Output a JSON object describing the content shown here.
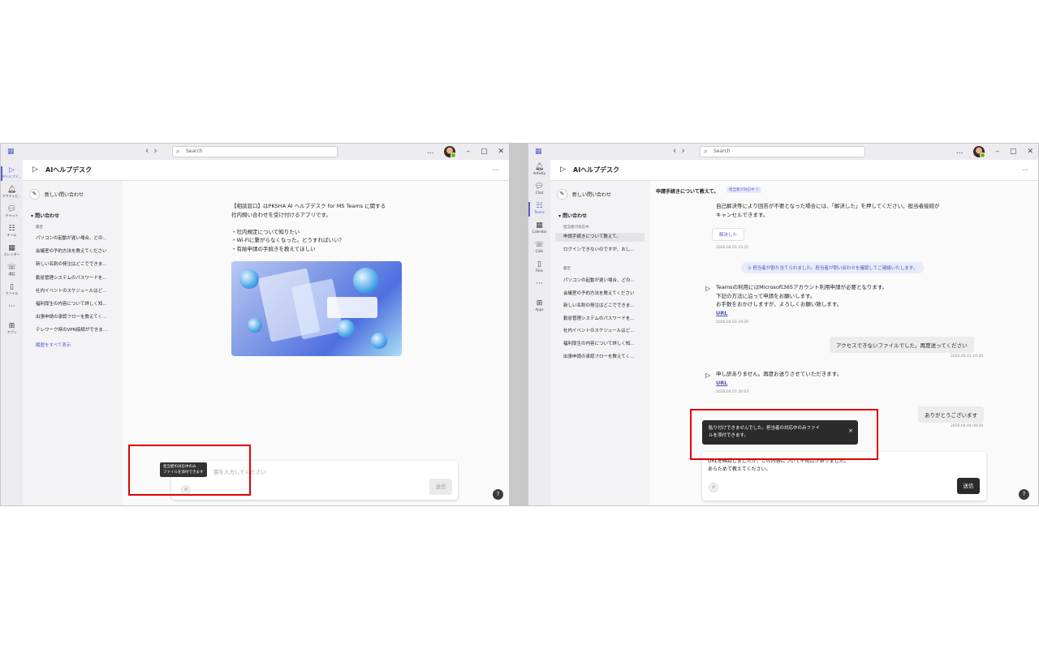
{
  "common": {
    "search_placeholder": "Search",
    "app_title": "AIヘルプデスク",
    "new_chat": "新しい問い合わせ",
    "section_header": "問い合わせ",
    "recent_label": "最近",
    "send_label": "送信",
    "help": "?",
    "more": "..."
  },
  "left": {
    "rail": [
      {
        "label": "AIヘルプデ...",
        "icon": "play-icon",
        "glyph": "▷",
        "active": true
      },
      {
        "label": "アクティビ...",
        "icon": "bell-icon",
        "glyph": "🔔︎",
        "active": false
      },
      {
        "label": "チャット",
        "icon": "chat-icon",
        "glyph": "💬︎",
        "active": false
      },
      {
        "label": "チーム",
        "icon": "teams-icon",
        "glyph": "☷",
        "active": false
      },
      {
        "label": "カレンダー",
        "icon": "calendar-icon",
        "glyph": "▦",
        "active": false
      },
      {
        "label": "通話",
        "icon": "phone-icon",
        "glyph": "☏",
        "active": false
      },
      {
        "label": "ファイル",
        "icon": "file-icon",
        "glyph": "▯",
        "active": false
      },
      {
        "label": "",
        "icon": "more-icon",
        "glyph": "···",
        "active": false
      },
      {
        "label": "アプリ",
        "icon": "apps-icon",
        "glyph": "⊞",
        "active": false
      }
    ],
    "recent_items": [
      "パソコンの起動が遅い場合、どの...",
      "会議室の予約方法を教えてください",
      "新しい名刺の発注はどこでできま...",
      "勤怠管理システムのパスワードを...",
      "社内イベントのスケジュールはど...",
      "福利厚生の内容について詳しく知...",
      "出張申請の承認フローを教えてく...",
      "テレワーク時のVPN接続ができま..."
    ],
    "show_all": "履歴をすべて表示",
    "welcome_lines": [
      "【相談窓口】はPKSHA AI ヘルプデスク for MS Teams に関する",
      "社内問い合わせを受け付けるアプリです。",
      "",
      "・社内規定について知りたい",
      "・Wi-Fiに繋がらなくなった。どうすればいい？",
      "・有給申請の手続きを教えてほしい"
    ],
    "composer_placeholder": "容を入力してください",
    "tooltip_lines": [
      "担当者の対応中のみ",
      "ファイルを添付できます"
    ]
  },
  "right": {
    "rail": [
      {
        "label": "Activity",
        "icon": "bell-icon",
        "glyph": "🔔︎",
        "active": false
      },
      {
        "label": "Chat",
        "icon": "chat-icon",
        "glyph": "💬︎",
        "active": false
      },
      {
        "label": "Teams",
        "icon": "teams-icon",
        "glyph": "☷",
        "active": true
      },
      {
        "label": "Calendar",
        "icon": "calendar-icon",
        "glyph": "▦",
        "active": false
      },
      {
        "label": "Calls",
        "icon": "phone-icon",
        "glyph": "☏",
        "active": false
      },
      {
        "label": "Files",
        "icon": "file-icon",
        "glyph": "▯",
        "active": false
      },
      {
        "label": "",
        "icon": "more-icon",
        "glyph": "···",
        "active": false
      },
      {
        "label": "Apps",
        "icon": "apps-icon",
        "glyph": "⊞",
        "active": false
      }
    ],
    "agent_label": "担当者が対応中",
    "agent_items": [
      "申請手続きについて教えて。",
      "ログインできないのですが、おし..."
    ],
    "recent_items": [
      "パソコンの起動が遅い場合、どの...",
      "会議室の予約方法を教えてください",
      "新しい名刺の発注はどこでできま...",
      "勤怠管理システムのパスワードを...",
      "社内イベントのスケジュールはど...",
      "福利厚生の内容について詳しく知...",
      "出張申請の承認フローを教えてく..."
    ],
    "conversation_title": "申請手続きについて教えて。",
    "conversation_badge": "担当者が対応中 ⓔ",
    "msg1_lines": [
      "自己解決等により回答が不要となった場合には、「解決した」を押してください。担当者接続が",
      "キャンセルできます。"
    ],
    "resolve_button": "解決した",
    "msg1_time": "2026.04.03 15:25",
    "notice": "⊙ 担当者が割り当てられました。担当者が問い合わせを確認してご連絡いたします。",
    "msg2_lines": [
      "Teamsの利用にはMicrosoft365アカウント利用申請が必要となります。",
      "下記の方法に沿って申請をお願いします。",
      "お手数をおかけしますが、よろしくお願い致します。"
    ],
    "msg2_link": "URL",
    "msg2_time": "2026.04.03 19:26",
    "user_msg1": "アクセスできないファイルでした。再度送ってください",
    "user_msg1_time": "2026.04.03 19:30",
    "msg3": "申し訳ありません。再度お送りさせていただきます。",
    "msg3_link": "URL",
    "msg3_time": "2026.04.03 20:03",
    "user_msg2": "ありがとうございます",
    "user_msg2_time": "2026.04.04 09:20",
    "toast_lines": [
      "貼り付けできませんでした。担当者の対応中のみファイ",
      "ルを添付できます。"
    ],
    "toast_close": "×",
    "composer_lines": [
      "URLを確認しましたが、この内容について不明点がありました。",
      "あらためて教えてください。"
    ]
  }
}
